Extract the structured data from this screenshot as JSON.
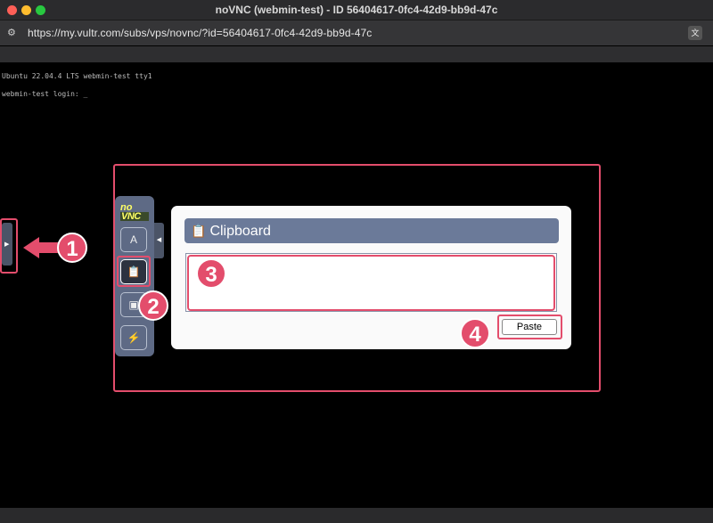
{
  "window": {
    "title": "noVNC (webmin-test) - ID 56404617-0fc4-42d9-bb9d-47c"
  },
  "browser": {
    "url": "https://my.vultr.com/subs/vps/novnc/?id=56404617-0fc4-42d9-bb9d-47c",
    "site_icon": "tune-icon",
    "translate_icon": "translate-icon"
  },
  "terminal": {
    "lines": [
      "Ubuntu 22.04.4 LTS webmin-test tty1",
      "webmin-test login: _"
    ]
  },
  "novnc": {
    "logo_top": "no",
    "logo_bottom": "VNC",
    "tools": [
      {
        "name": "keyboard",
        "icon": "keyboard-a-icon",
        "glyph": "A"
      },
      {
        "name": "clipboard",
        "icon": "clipboard-icon",
        "glyph": "📋"
      },
      {
        "name": "send-keys",
        "icon": "ctrl-alt-del-icon",
        "glyph": "▣"
      },
      {
        "name": "disconnect",
        "icon": "disconnect-icon",
        "glyph": "⚡"
      }
    ],
    "clipboard": {
      "title": "Clipboard",
      "text_value": "",
      "paste_label": "Paste"
    }
  },
  "callouts": [
    "1",
    "2",
    "3",
    "4"
  ],
  "colors": {
    "highlight": "#e34d6c",
    "panel": "#5e6a85",
    "header": "#6b7a99"
  }
}
